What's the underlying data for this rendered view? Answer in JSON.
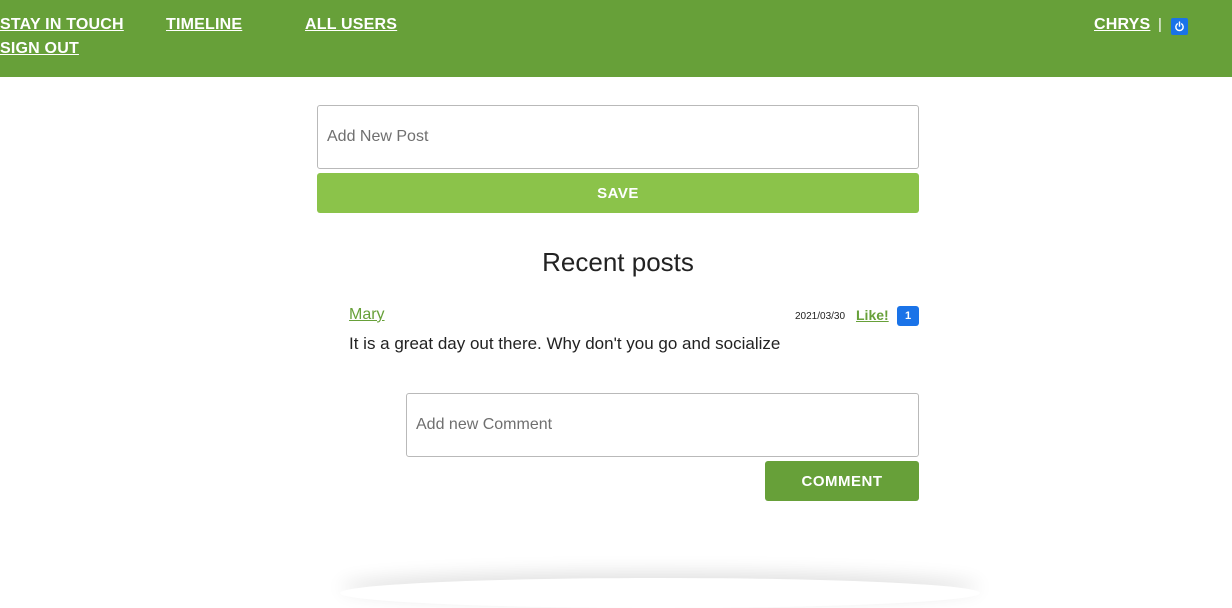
{
  "nav": {
    "brand": "STAY IN TOUCH",
    "timeline": "TIMELINE",
    "all_users": "ALL USERS",
    "sign_out": "SIGN OUT",
    "user": "CHRYS",
    "separator": "|",
    "power_icon": "power-icon"
  },
  "new_post": {
    "placeholder": "Add New Post",
    "value": "",
    "save_label": "SAVE"
  },
  "recent": {
    "title": "Recent posts",
    "posts": [
      {
        "author": "Mary",
        "date": "2021/03/30",
        "like_label": "Like!",
        "like_count": "1",
        "body": "It is a great day out there. Why don't you go and socialize",
        "comment_placeholder": "Add new Comment",
        "comment_label": "COMMENT"
      }
    ]
  },
  "colors": {
    "header": "#67a039",
    "save_button": "#8bc34a",
    "comment_button": "#67a039",
    "like_badge": "#1a73e8"
  }
}
